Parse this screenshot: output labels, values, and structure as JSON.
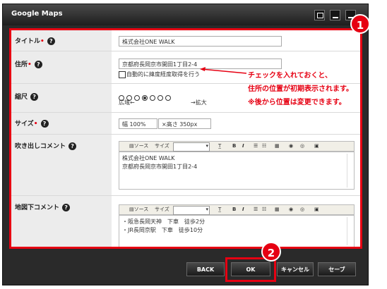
{
  "dialog": {
    "title": "Google Maps"
  },
  "fields": {
    "title": {
      "label": "タイトル",
      "value": "株式会社ONE WALK"
    },
    "address": {
      "label": "住所",
      "value": "京都府長岡京市開田1丁目2-4",
      "auto_checkbox_label": "自動的に緯度経度取得を行う"
    },
    "scale": {
      "label": "縮尺",
      "left_caption": "広域←",
      "right_caption": "→拡大",
      "options_count": 7,
      "selected_index": 3
    },
    "size": {
      "label": "サイズ",
      "width_label": "幅",
      "width_value": "100%",
      "height_label": "×高さ",
      "height_value": "350px"
    },
    "balloon_comment": {
      "label": "吹き出しコメント",
      "lines": [
        "株式会社ONE WALK",
        "京都府長岡京市開田1丁目2-4"
      ]
    },
    "map_comment": {
      "label": "地図下コメント",
      "lines": [
        "・阪急長岡天神　下車　徒歩2分",
        "・JR長岡京駅　下車　徒歩10分"
      ]
    }
  },
  "toolbar": {
    "source": "ソース",
    "size": "サイズ",
    "bold": "B",
    "italic": "I"
  },
  "buttons": {
    "back": "BACK",
    "ok": "OK",
    "cancel": "キャンセル",
    "save": "セーブ"
  },
  "badges": {
    "one": "1",
    "two": "2"
  },
  "annotation": {
    "line1": "チェックを入れておくと、",
    "line2": "住所の位置が初期表示されます。",
    "line3": "※後から位置は変更できます。"
  },
  "colors": {
    "accent": "#e60012",
    "dialog_bg": "#2a2a2a"
  }
}
